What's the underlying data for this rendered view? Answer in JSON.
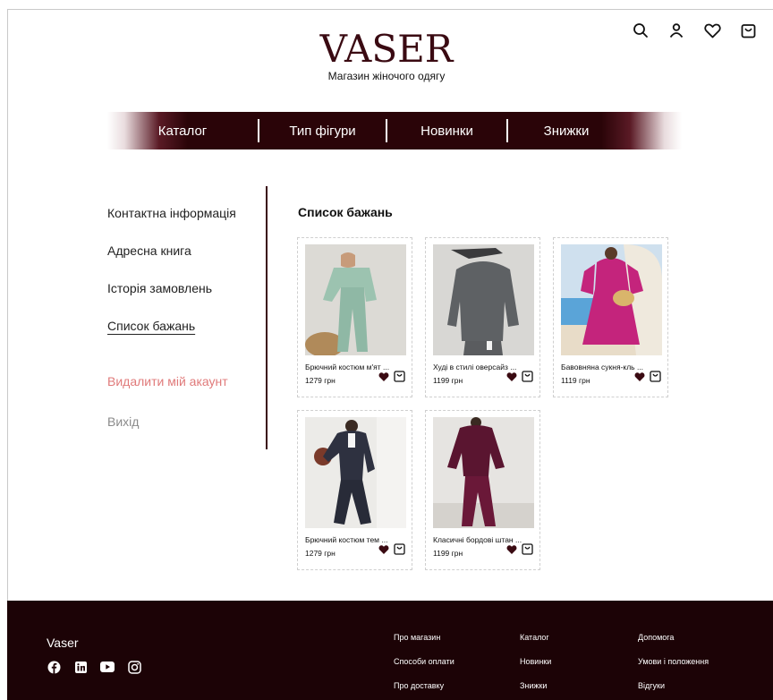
{
  "header": {
    "logo": "VASER",
    "tagline": "Магазин жіночого одягу",
    "icons": [
      "search-icon",
      "user-icon",
      "heart-icon",
      "shopping-bag-icon"
    ]
  },
  "nav": {
    "items": [
      {
        "label": "Каталог"
      },
      {
        "label": "Тип фігури"
      },
      {
        "label": "Новинки"
      },
      {
        "label": "Знижки"
      }
    ]
  },
  "sidebar": {
    "contact": "Контактна інформація",
    "address": "Адресна книга",
    "orders": "Історія замовлень",
    "wishlist": "Список бажань",
    "delete": "Видалити мій акаунт",
    "exit": "Вихід"
  },
  "wishlist": {
    "title": "Список бажань",
    "products": [
      {
        "name": "Брючний костюм м'ят ...",
        "price": "1279 грн"
      },
      {
        "name": "Худі в стилі оверсайз ...",
        "price": "1199 грн"
      },
      {
        "name": "Бавовняна сукня-кль ...",
        "price": "1119 грн"
      },
      {
        "name": "Брючний костюм тем ...",
        "price": "1279 грн"
      },
      {
        "name": "Класичні бордові штан ...",
        "price": "1199 грн"
      }
    ]
  },
  "footer": {
    "brand": "Vaser",
    "socials": [
      "facebook-icon",
      "linkedin-icon",
      "youtube-icon",
      "instagram-icon"
    ],
    "col1": [
      "Про магазин",
      "Способи оплати",
      "Про доставку"
    ],
    "col2": [
      "Каталог",
      "Новинки",
      "Знижки"
    ],
    "col3": [
      "Допомога",
      "Умови і положення",
      "Відгуки"
    ]
  },
  "colors": {
    "brand_dark": "#2a0408",
    "footer_bg": "#1c0306",
    "delete_text": "#e07a7a",
    "heart_fill": "#3a0a12"
  }
}
